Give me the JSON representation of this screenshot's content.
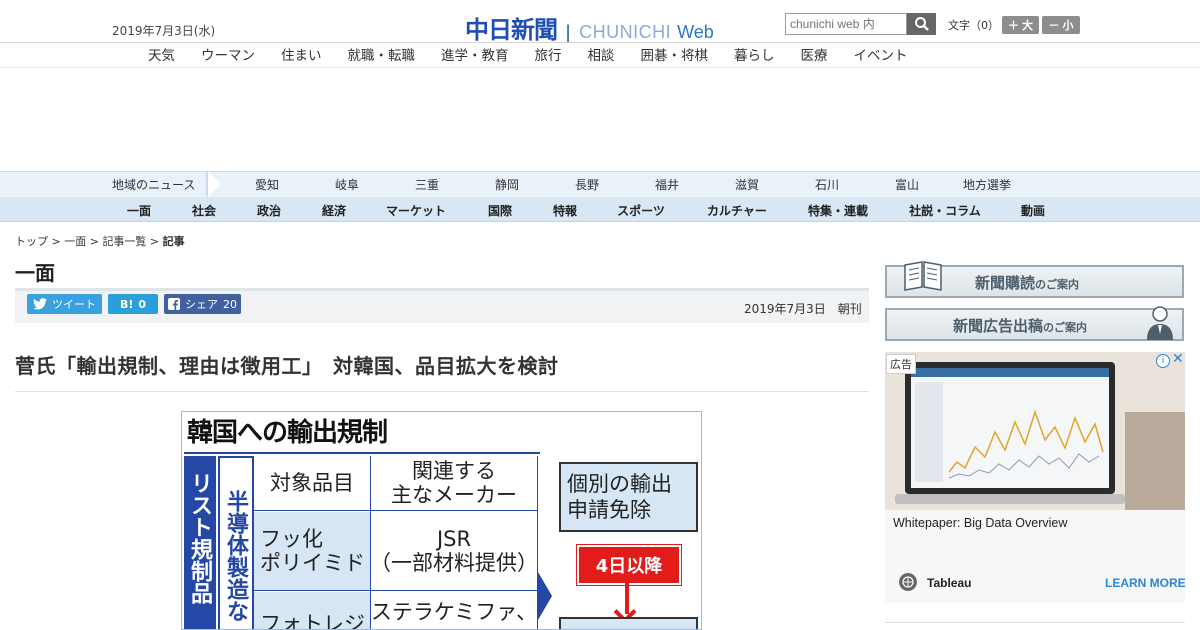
{
  "header": {
    "date": "2019年7月3日(水)",
    "logo_ja": "中日新聞",
    "logo_en1": "CHUNICHI",
    "logo_en2": "Web",
    "search_placeholder": "chunichi web 内",
    "textsize_label": "文字（0）",
    "size_up_label": "大",
    "size_down_label": "小"
  },
  "category_nav": [
    "天気",
    "ウーマン",
    "住まい",
    "就職・転職",
    "進学・教育",
    "旅行",
    "相談",
    "囲碁・将棋",
    "暮らし",
    "医療",
    "イベント"
  ],
  "regional_nav": {
    "label": "地域のニュース",
    "items": [
      "愛知",
      "岐阜",
      "三重",
      "静岡",
      "長野",
      "福井",
      "滋賀",
      "石川",
      "富山",
      "地方選挙"
    ]
  },
  "section_nav": [
    "一面",
    "社会",
    "政治",
    "経済",
    "マーケット",
    "国際",
    "特報",
    "スポーツ",
    "カルチャー",
    "特集・連載",
    "社説・コラム",
    "動画"
  ],
  "breadcrumb": {
    "items": [
      "トップ",
      "一面",
      "記事一覧"
    ],
    "current": "記事"
  },
  "article": {
    "section_heading": "一面",
    "tweet_label": "ツイート",
    "hatena_label": "B!",
    "hatena_count": "0",
    "facebook_label": "シェア",
    "facebook_count": "20",
    "date": "2019年7月3日　朝刊",
    "headline": "菅氏「輸出規制、理由は徴用工」　対韓国、品目拡大を検討"
  },
  "figure": {
    "title": "韓国への輸出規制",
    "left_label": "リスト規制品",
    "semi_label": "半導体製造な",
    "header_item": "対象品目",
    "header_maker_line1": "関連する",
    "header_maker_line2": "主なメーカー",
    "row1_item_line1": "フッ化",
    "row1_item_line2": "ポリイミド",
    "row1_maker_line1": "JSR",
    "row1_maker_line2": "（一部材料提供）",
    "row2_item": "フォトレジ",
    "row2_maker": "ステラケミファ、",
    "right_box_line1": "個別の輸出",
    "right_box_line2": "申請免除",
    "badge": "4日以降"
  },
  "sidebar": {
    "promo1_main": "新聞購読",
    "promo1_sub": "のご案内",
    "promo2_main": "新聞広告出稿",
    "promo2_sub": "のご案内",
    "ad_label": "広告",
    "ad_title": "Whitepaper: Big Data Overview",
    "ad_brand": "Tableau",
    "ad_cta": "LEARN MORE"
  }
}
